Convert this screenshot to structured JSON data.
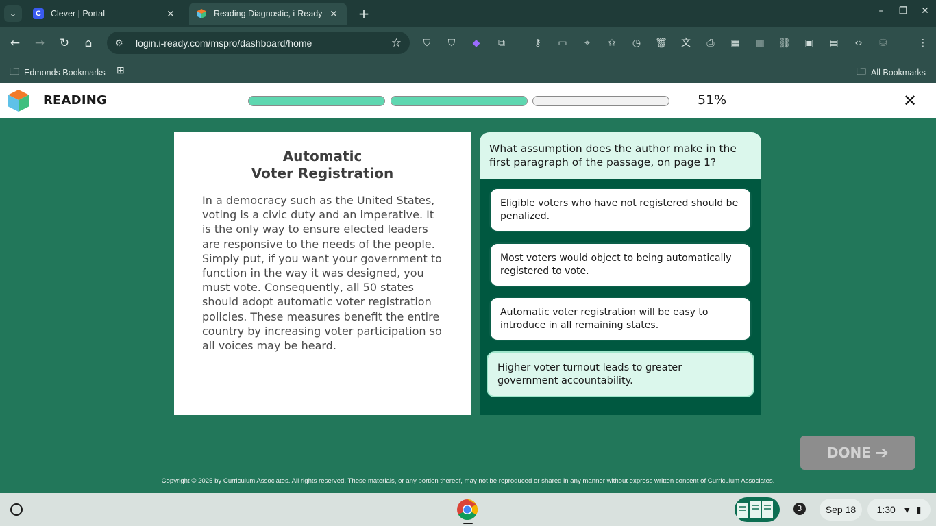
{
  "browser": {
    "tabs": [
      {
        "title": "Clever | Portal",
        "favicon": "C",
        "favicon_color": "#3a5bf0"
      },
      {
        "title": "Reading Diagnostic, i-Ready",
        "favicon": "iready-cube",
        "active": true
      }
    ],
    "url": "login.i-ready.com/mspro/dashboard/home",
    "bookmarks": {
      "left": "Edmonds Bookmarks",
      "right": "All Bookmarks"
    }
  },
  "app": {
    "subject": "READING",
    "progress_percent": "51%",
    "progress_segments": [
      1.0,
      1.0,
      0.0
    ]
  },
  "passage": {
    "title_line1": "Automatic",
    "title_line2": "Voter Registration",
    "body": "In a democracy such as the United States, voting is a civic duty and an imperative. It is the only way to ensure elected leaders are responsive to the needs of the people. Simply put, if you want your government to function in the way it was designed, you must vote. Consequently, all 50 states should adopt automatic voter registration policies. These measures benefit the entire country by increasing voter participation so all voices may be heard."
  },
  "question": {
    "prompt": "What assumption does the author make in the first paragraph of the passage, on page 1?",
    "choices": [
      {
        "text": "Eligible voters who have not registered should be penalized."
      },
      {
        "text": "Most voters would object to being automatically registered to vote."
      },
      {
        "text": "Automatic voter registration will be easy to introduce in all remaining states."
      },
      {
        "text": "Higher voter turnout leads to greater government accountability.",
        "selected": true
      }
    ]
  },
  "done_label": "DONE",
  "copyright": "Copyright © 2025 by Curriculum Associates. All rights reserved. These materials, or any portion thereof, may not be reproduced or shared in any manner without express written consent of Curriculum Associates.",
  "shelf": {
    "notification_count": "3",
    "date": "Sep 18",
    "time": "1:30"
  },
  "colors": {
    "page_bg": "#22775a",
    "progress_fill": "#5fd7b0",
    "question_panel": "#005840",
    "selected_choice": "#dbf7ec"
  }
}
